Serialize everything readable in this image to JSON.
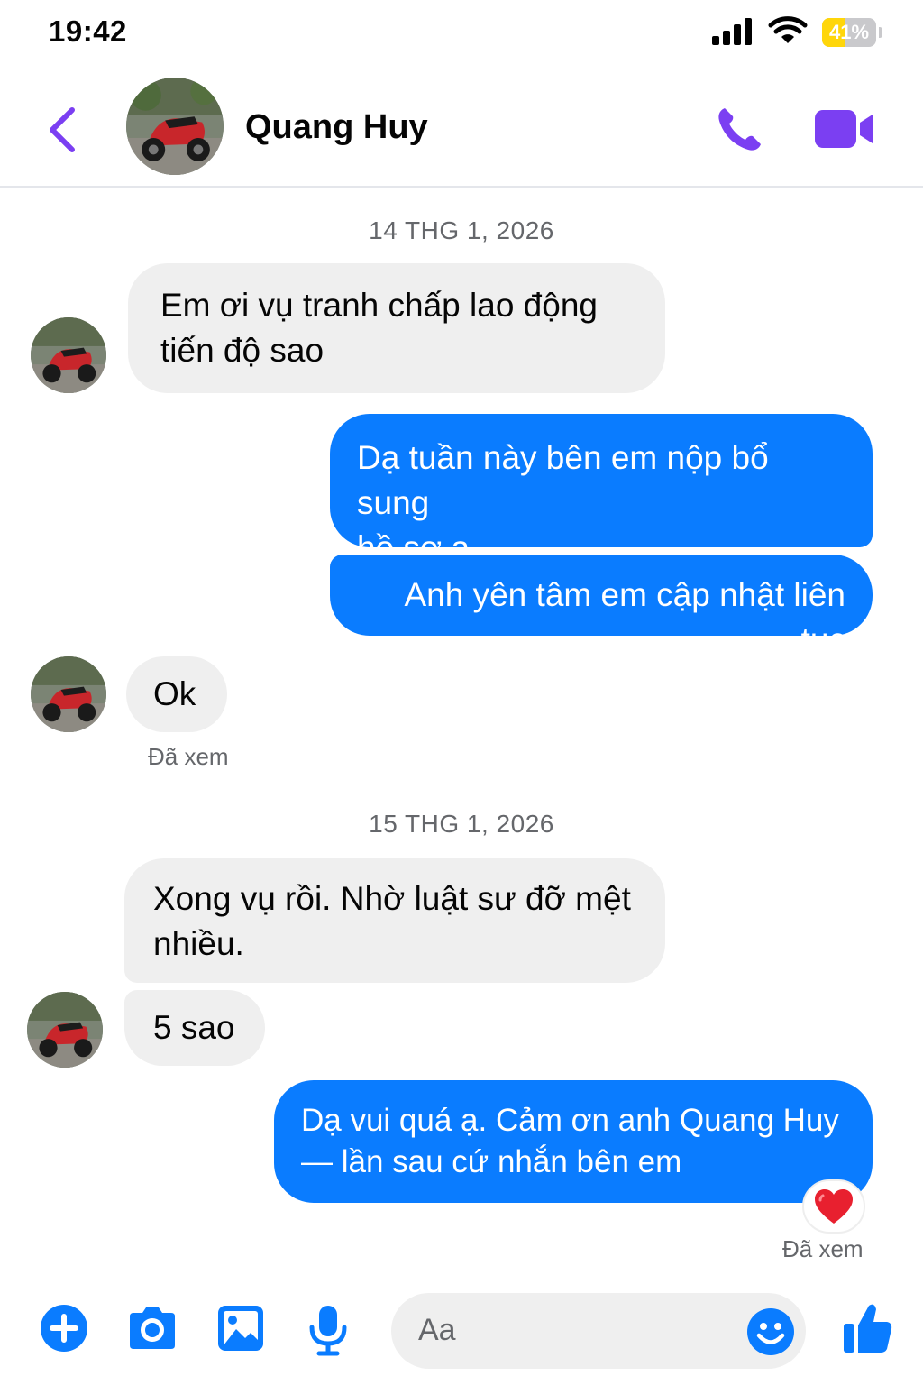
{
  "status_bar": {
    "time": "19:42",
    "battery_percent": "41%",
    "battery_level": 0.41
  },
  "header": {
    "contact_name": "Quang Huy"
  },
  "conversation": {
    "date_1": "14 THG 1, 2026",
    "msg_1": [
      "Em ơi vụ tranh chấp lao động",
      "tiến độ sao"
    ],
    "msg_2": [
      "Dạ tuần này bên em nộp bổ sung",
      "hồ sơ ạ"
    ],
    "msg_3": "Anh yên tâm em cập nhật liên tục",
    "msg_4": "Ok",
    "seen_1": "Đã xem",
    "date_2": "15 THG 1, 2026",
    "msg_5": [
      "Xong vụ rồi. Nhờ luật sư đỡ mệt",
      "nhiều."
    ],
    "msg_6": "5 sao",
    "msg_7": [
      "Dạ vui quá ạ. Cảm ơn anh Quang Huy",
      "— lần sau cứ nhắn bên em"
    ],
    "reaction": "heart",
    "seen_2": "Đã xem"
  },
  "composer": {
    "placeholder": "Aa"
  },
  "colors": {
    "accent": "#7b3ff2",
    "outgoing_bubble": "#0a7cff",
    "incoming_bubble": "#efefef"
  },
  "icons": [
    "back-chevron",
    "phone",
    "video-camera",
    "plus",
    "camera",
    "image",
    "microphone",
    "smiley",
    "thumbs-up",
    "heart"
  ]
}
